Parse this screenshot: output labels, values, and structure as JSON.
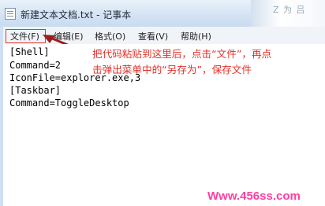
{
  "window": {
    "title": "新建文本文档.txt - 记事本",
    "background_text_fragment": "Z 为 吕"
  },
  "menubar": {
    "items": [
      {
        "label": "文件(F)"
      },
      {
        "label": "编辑(E)"
      },
      {
        "label": "格式(O)"
      },
      {
        "label": "查看(V)"
      },
      {
        "label": "帮助(H)"
      }
    ]
  },
  "editor": {
    "lines": [
      "[Shell]",
      "Command=2",
      "IconFile=explorer.exe,3",
      "[Taskbar]",
      "Command=ToggleDesktop"
    ]
  },
  "annotation": {
    "line1": "把代码粘贴到这里后，点击“文件”，再点",
    "line2": "击弹出菜单中的“另存为”，保存文件",
    "color": "#e0312b"
  },
  "watermark": {
    "text": "Www.456ss.com",
    "color": "#ff3fa0"
  }
}
